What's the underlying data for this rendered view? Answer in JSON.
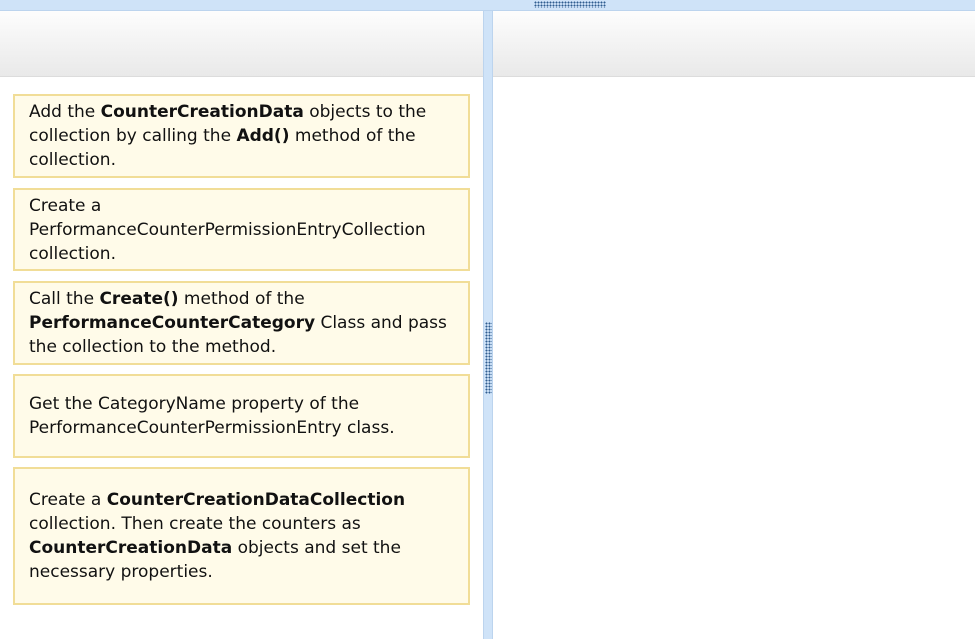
{
  "items": [
    {
      "segments": [
        {
          "text": "Add the ",
          "bold": false
        },
        {
          "text": "CounterCreationData",
          "bold": true
        },
        {
          "text": " objects to the collection by calling the ",
          "bold": false
        },
        {
          "text": "Add()",
          "bold": true
        },
        {
          "text": " method of the collection.",
          "bold": false
        }
      ]
    },
    {
      "segments": [
        {
          "text": "Create a PerformanceCounterPermissionEntryCollection collection.",
          "bold": false
        }
      ]
    },
    {
      "segments": [
        {
          "text": "Call the ",
          "bold": false
        },
        {
          "text": "Create()",
          "bold": true
        },
        {
          "text": " method of the ",
          "bold": false
        },
        {
          "text": "PerformanceCounterCategory",
          "bold": true
        },
        {
          "text": " Class and pass the collection to the method.",
          "bold": false
        }
      ]
    },
    {
      "segments": [
        {
          "text": "Get the CategoryName property of the PerformanceCounterPermissionEntry class.",
          "bold": false
        }
      ]
    },
    {
      "segments": [
        {
          "text": "Create a ",
          "bold": false
        },
        {
          "text": "CounterCreationDataCollection",
          "bold": true
        },
        {
          "text": " collection. Then create the counters as ",
          "bold": false
        },
        {
          "text": "CounterCreationData",
          "bold": true
        },
        {
          "text": " objects and set the necessary properties.",
          "bold": false
        }
      ]
    }
  ]
}
